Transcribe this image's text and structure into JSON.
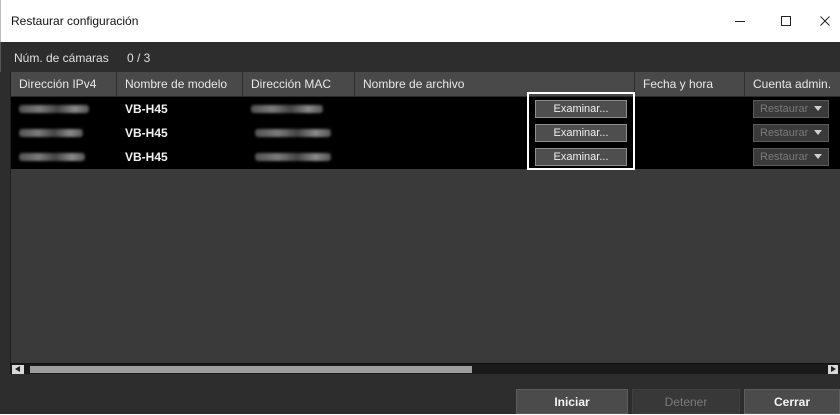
{
  "window": {
    "title": "Restaurar configuración",
    "controls": {
      "minimize": "—",
      "maximize": "☐",
      "close": "✕"
    }
  },
  "summary": {
    "label": "Núm. de cámaras",
    "value": "0 / 3"
  },
  "table": {
    "columns": [
      "Dirección IPv4",
      "Nombre de modelo",
      "Dirección MAC",
      "Nombre de archivo",
      "Fecha y hora",
      "Cuenta admin."
    ],
    "rows": [
      {
        "ipv4": "",
        "model": "VB-H45",
        "mac": "",
        "file": "",
        "datetime": "",
        "browse_label": "Examinar...",
        "account_label": "Restaurar"
      },
      {
        "ipv4": "",
        "model": "VB-H45",
        "mac": "",
        "file": "",
        "datetime": "",
        "browse_label": "Examinar...",
        "account_label": "Restaurar"
      },
      {
        "ipv4": "",
        "model": "VB-H45",
        "mac": "",
        "file": "",
        "datetime": "",
        "browse_label": "Examinar...",
        "account_label": "Restaurar"
      }
    ]
  },
  "footer": {
    "start_label": "Iniciar",
    "stop_label": "Detener",
    "close_label": "Cerrar"
  },
  "colors": {
    "background": "#2d2d2d",
    "row_background": "#000000",
    "header_background": "#494949",
    "highlight_border": "#ffffff"
  }
}
